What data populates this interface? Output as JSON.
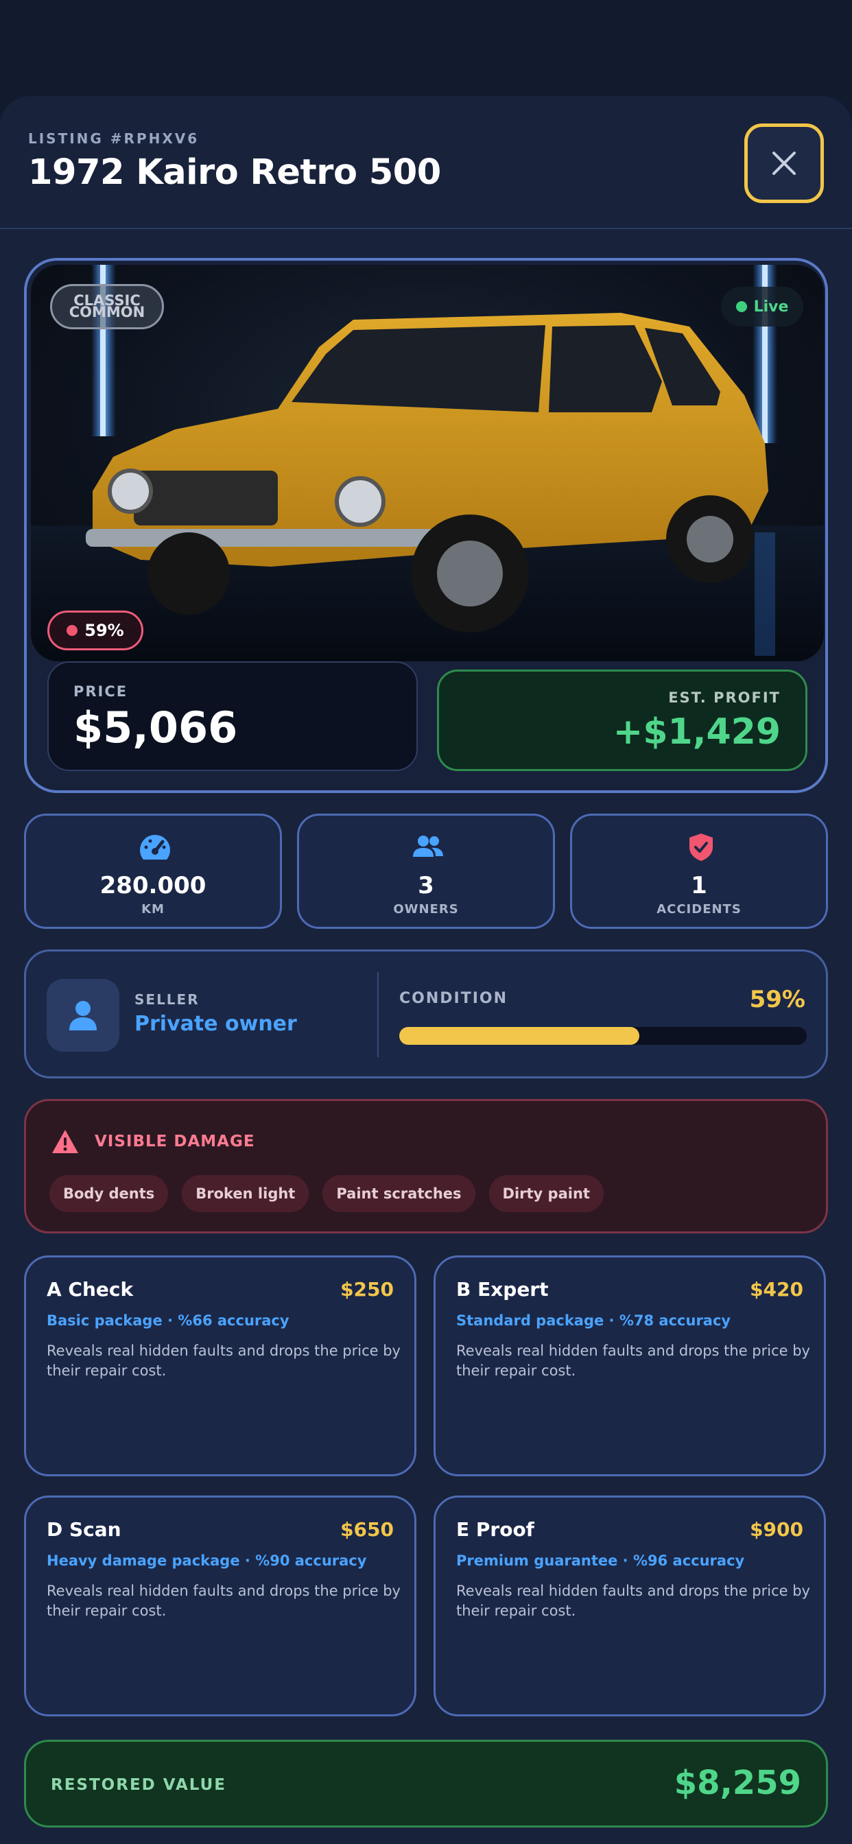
{
  "header": {
    "listing_id": "LISTING #RPHXV6",
    "title": "1972 Kairo Retro 500"
  },
  "hero": {
    "class_badge_line1": "CLASSIC",
    "class_badge_line2": "COMMON",
    "status": "Live",
    "condition_badge": "59%",
    "price_label": "PRICE",
    "price": "$5,066",
    "profit_label": "EST. PROFIT",
    "profit": "+$1,429"
  },
  "stats": [
    {
      "icon": "speedometer-icon",
      "value": "280.000",
      "label": "KM"
    },
    {
      "icon": "people-icon",
      "value": "3",
      "label": "OWNERS"
    },
    {
      "icon": "shield-check-icon",
      "value": "1",
      "label": "ACCIDENTS"
    }
  ],
  "seller": {
    "label": "SELLER",
    "value": "Private owner",
    "condition_label": "CONDITION",
    "condition_value": "59%",
    "condition_level": 0.59
  },
  "damage": {
    "title": "VISIBLE DAMAGE",
    "tags": [
      "Body dents",
      "Broken light",
      "Paint scratches",
      "Dirty paint"
    ]
  },
  "packages": [
    {
      "name": "A Check",
      "price": "$250",
      "sub": "Basic package · %66 accuracy",
      "desc": "Reveals real hidden faults and drops the price by their repair cost."
    },
    {
      "name": "B Expert",
      "price": "$420",
      "sub": "Standard package · %78 accuracy",
      "desc": "Reveals real hidden faults and drops the price by their repair cost."
    },
    {
      "name": "D Scan",
      "price": "$650",
      "sub": "Heavy damage package · %90 accuracy",
      "desc": "Reveals real hidden faults and drops the price by their repair cost."
    },
    {
      "name": "E Proof",
      "price": "$900",
      "sub": "Premium guarantee · %96 accuracy",
      "desc": "Reveals real hidden faults and drops the price by their repair cost."
    }
  ],
  "restored": {
    "label": "RESTORED VALUE",
    "value": "$8,259"
  },
  "colors": {
    "accent_yellow": "#f2c64a",
    "accent_green": "#4fd68a",
    "accent_blue": "#4aa3ff",
    "danger": "#ff7b92"
  }
}
